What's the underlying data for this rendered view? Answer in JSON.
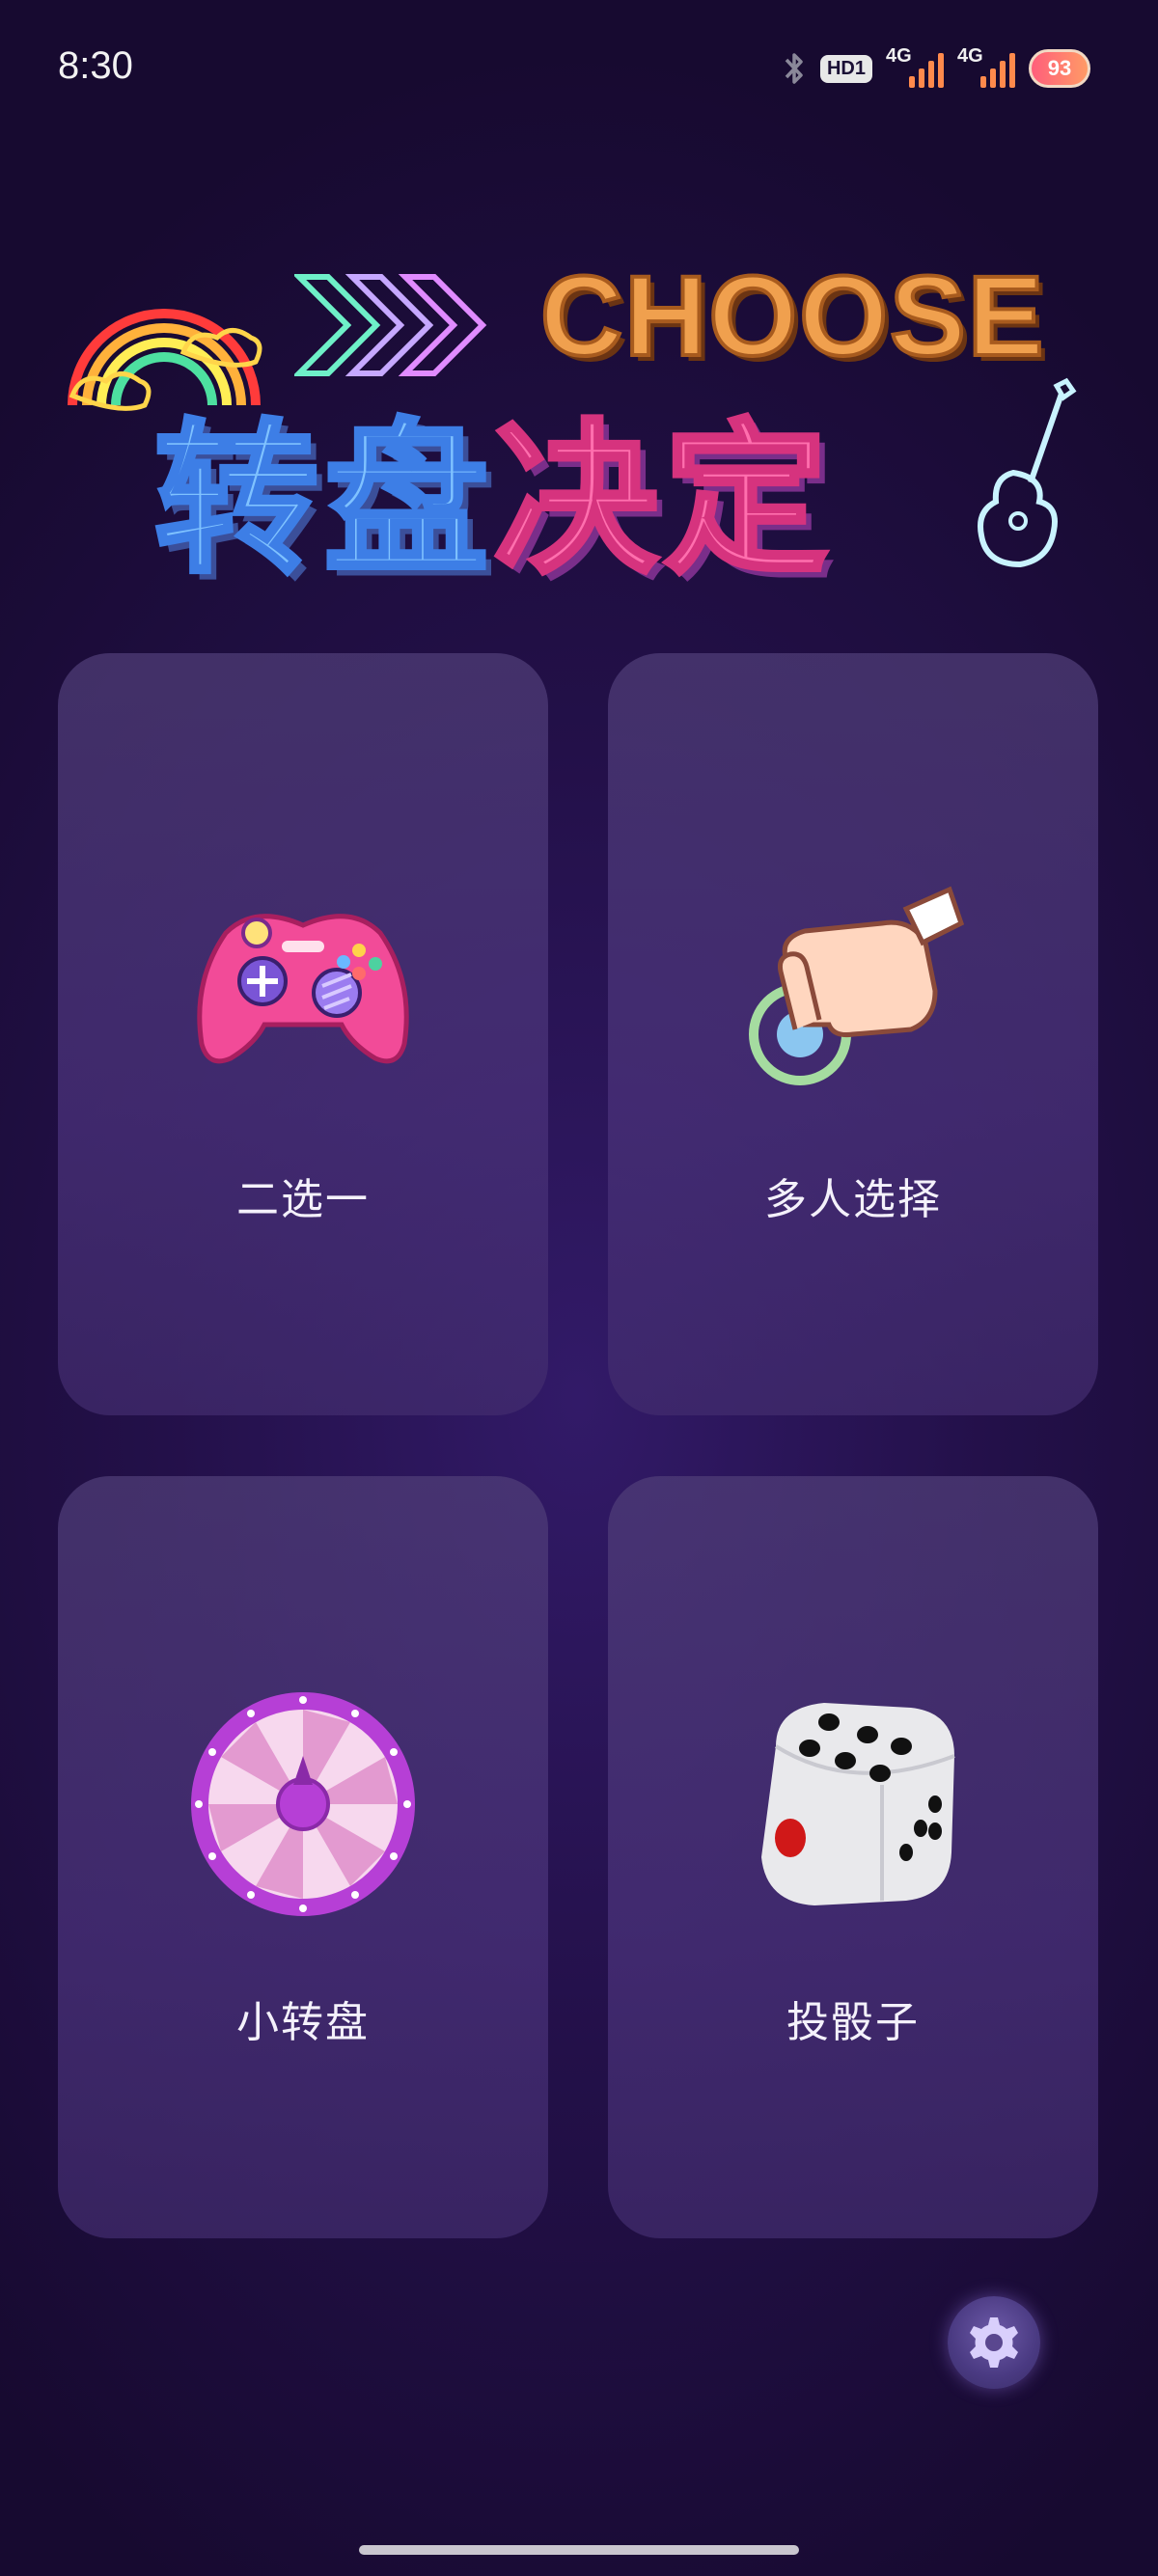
{
  "status_bar": {
    "time": "8:30",
    "hd_badge": "HD1",
    "signal_1_label": "4G",
    "signal_2_label": "4G",
    "battery": "93",
    "icons": [
      "bluetooth-icon",
      "signal-icon",
      "signal-icon",
      "battery-icon"
    ]
  },
  "banner": {
    "choose_text": "CHOOSE",
    "title_part1": "转盘",
    "title_part2": "决定",
    "decorations": [
      "rainbow-icon",
      "arrows-icon",
      "guitar-icon"
    ]
  },
  "cards": [
    {
      "label": "二选一",
      "icon": "gamepad-icon"
    },
    {
      "label": "多人选择",
      "icon": "pointing-hand-icon"
    },
    {
      "label": "小转盘",
      "icon": "spin-wheel-icon"
    },
    {
      "label": "投骰子",
      "icon": "dice-icon"
    }
  ],
  "settings": {
    "icon": "gear-icon"
  },
  "colors": {
    "background": "#231049",
    "card": "#4a3578",
    "accent_orange": "#f0a04e",
    "accent_blue": "#7fc2ff",
    "accent_pink": "#ff6fae"
  }
}
